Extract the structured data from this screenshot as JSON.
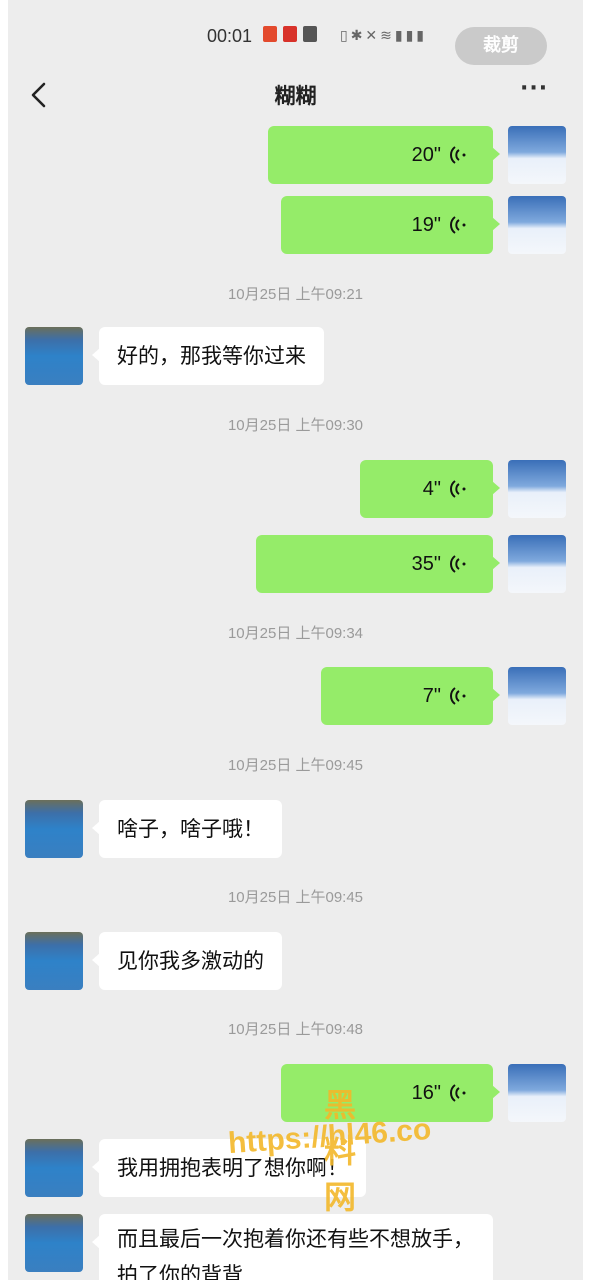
{
  "status_bar": {
    "time": "00:01",
    "crop_label": "裁剪"
  },
  "header": {
    "title": "糊糊",
    "more": "···"
  },
  "messages": [
    {
      "kind": "voice",
      "side": "self",
      "duration": "20\""
    },
    {
      "kind": "voice",
      "side": "self",
      "duration": "19\""
    },
    {
      "kind": "time",
      "text": "10月25日 上午09:21"
    },
    {
      "kind": "text",
      "side": "other",
      "text": "好的，那我等你过来"
    },
    {
      "kind": "time",
      "text": "10月25日 上午09:30"
    },
    {
      "kind": "voice",
      "side": "self",
      "duration": "4\""
    },
    {
      "kind": "voice",
      "side": "self",
      "duration": "35\""
    },
    {
      "kind": "time",
      "text": "10月25日 上午09:34"
    },
    {
      "kind": "voice",
      "side": "self",
      "duration": "7\""
    },
    {
      "kind": "time",
      "text": "10月25日 上午09:45"
    },
    {
      "kind": "text",
      "side": "other",
      "text": "啥子，啥子哦！"
    },
    {
      "kind": "time",
      "text": "10月25日 上午09:45"
    },
    {
      "kind": "text",
      "side": "other",
      "text": "见你我多激动的"
    },
    {
      "kind": "time",
      "text": "10月25日 上午09:48"
    },
    {
      "kind": "voice",
      "side": "self",
      "duration": "16\""
    },
    {
      "kind": "text",
      "side": "other",
      "text": "我用拥抱表明了想你啊！"
    },
    {
      "kind": "text",
      "side": "other",
      "text": "而且最后一次抱着你还有些不想放手，拍了你的背背"
    }
  ],
  "watermark": {
    "line1": "黑料网",
    "line2": "https://hl46.co"
  },
  "colors": {
    "background": "#ededed",
    "self_bubble": "#95ec69",
    "other_bubble": "#ffffff",
    "timestamp": "#9a9a9a",
    "watermark": "#f3b82a"
  }
}
